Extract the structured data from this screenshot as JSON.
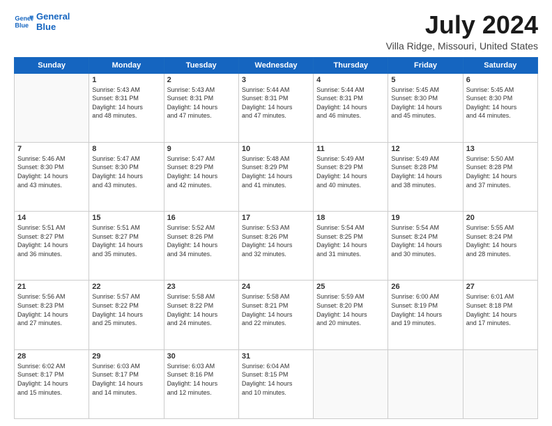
{
  "header": {
    "logo_line1": "General",
    "logo_line2": "Blue",
    "title": "July 2024",
    "subtitle": "Villa Ridge, Missouri, United States"
  },
  "calendar": {
    "days_of_week": [
      "Sunday",
      "Monday",
      "Tuesday",
      "Wednesday",
      "Thursday",
      "Friday",
      "Saturday"
    ],
    "weeks": [
      [
        {
          "day": "",
          "text": ""
        },
        {
          "day": "1",
          "text": "Sunrise: 5:43 AM\nSunset: 8:31 PM\nDaylight: 14 hours\nand 48 minutes."
        },
        {
          "day": "2",
          "text": "Sunrise: 5:43 AM\nSunset: 8:31 PM\nDaylight: 14 hours\nand 47 minutes."
        },
        {
          "day": "3",
          "text": "Sunrise: 5:44 AM\nSunset: 8:31 PM\nDaylight: 14 hours\nand 47 minutes."
        },
        {
          "day": "4",
          "text": "Sunrise: 5:44 AM\nSunset: 8:31 PM\nDaylight: 14 hours\nand 46 minutes."
        },
        {
          "day": "5",
          "text": "Sunrise: 5:45 AM\nSunset: 8:30 PM\nDaylight: 14 hours\nand 45 minutes."
        },
        {
          "day": "6",
          "text": "Sunrise: 5:45 AM\nSunset: 8:30 PM\nDaylight: 14 hours\nand 44 minutes."
        }
      ],
      [
        {
          "day": "7",
          "text": "Sunrise: 5:46 AM\nSunset: 8:30 PM\nDaylight: 14 hours\nand 43 minutes."
        },
        {
          "day": "8",
          "text": "Sunrise: 5:47 AM\nSunset: 8:30 PM\nDaylight: 14 hours\nand 43 minutes."
        },
        {
          "day": "9",
          "text": "Sunrise: 5:47 AM\nSunset: 8:29 PM\nDaylight: 14 hours\nand 42 minutes."
        },
        {
          "day": "10",
          "text": "Sunrise: 5:48 AM\nSunset: 8:29 PM\nDaylight: 14 hours\nand 41 minutes."
        },
        {
          "day": "11",
          "text": "Sunrise: 5:49 AM\nSunset: 8:29 PM\nDaylight: 14 hours\nand 40 minutes."
        },
        {
          "day": "12",
          "text": "Sunrise: 5:49 AM\nSunset: 8:28 PM\nDaylight: 14 hours\nand 38 minutes."
        },
        {
          "day": "13",
          "text": "Sunrise: 5:50 AM\nSunset: 8:28 PM\nDaylight: 14 hours\nand 37 minutes."
        }
      ],
      [
        {
          "day": "14",
          "text": "Sunrise: 5:51 AM\nSunset: 8:27 PM\nDaylight: 14 hours\nand 36 minutes."
        },
        {
          "day": "15",
          "text": "Sunrise: 5:51 AM\nSunset: 8:27 PM\nDaylight: 14 hours\nand 35 minutes."
        },
        {
          "day": "16",
          "text": "Sunrise: 5:52 AM\nSunset: 8:26 PM\nDaylight: 14 hours\nand 34 minutes."
        },
        {
          "day": "17",
          "text": "Sunrise: 5:53 AM\nSunset: 8:26 PM\nDaylight: 14 hours\nand 32 minutes."
        },
        {
          "day": "18",
          "text": "Sunrise: 5:54 AM\nSunset: 8:25 PM\nDaylight: 14 hours\nand 31 minutes."
        },
        {
          "day": "19",
          "text": "Sunrise: 5:54 AM\nSunset: 8:24 PM\nDaylight: 14 hours\nand 30 minutes."
        },
        {
          "day": "20",
          "text": "Sunrise: 5:55 AM\nSunset: 8:24 PM\nDaylight: 14 hours\nand 28 minutes."
        }
      ],
      [
        {
          "day": "21",
          "text": "Sunrise: 5:56 AM\nSunset: 8:23 PM\nDaylight: 14 hours\nand 27 minutes."
        },
        {
          "day": "22",
          "text": "Sunrise: 5:57 AM\nSunset: 8:22 PM\nDaylight: 14 hours\nand 25 minutes."
        },
        {
          "day": "23",
          "text": "Sunrise: 5:58 AM\nSunset: 8:22 PM\nDaylight: 14 hours\nand 24 minutes."
        },
        {
          "day": "24",
          "text": "Sunrise: 5:58 AM\nSunset: 8:21 PM\nDaylight: 14 hours\nand 22 minutes."
        },
        {
          "day": "25",
          "text": "Sunrise: 5:59 AM\nSunset: 8:20 PM\nDaylight: 14 hours\nand 20 minutes."
        },
        {
          "day": "26",
          "text": "Sunrise: 6:00 AM\nSunset: 8:19 PM\nDaylight: 14 hours\nand 19 minutes."
        },
        {
          "day": "27",
          "text": "Sunrise: 6:01 AM\nSunset: 8:18 PM\nDaylight: 14 hours\nand 17 minutes."
        }
      ],
      [
        {
          "day": "28",
          "text": "Sunrise: 6:02 AM\nSunset: 8:17 PM\nDaylight: 14 hours\nand 15 minutes."
        },
        {
          "day": "29",
          "text": "Sunrise: 6:03 AM\nSunset: 8:17 PM\nDaylight: 14 hours\nand 14 minutes."
        },
        {
          "day": "30",
          "text": "Sunrise: 6:03 AM\nSunset: 8:16 PM\nDaylight: 14 hours\nand 12 minutes."
        },
        {
          "day": "31",
          "text": "Sunrise: 6:04 AM\nSunset: 8:15 PM\nDaylight: 14 hours\nand 10 minutes."
        },
        {
          "day": "",
          "text": ""
        },
        {
          "day": "",
          "text": ""
        },
        {
          "day": "",
          "text": ""
        }
      ]
    ]
  }
}
